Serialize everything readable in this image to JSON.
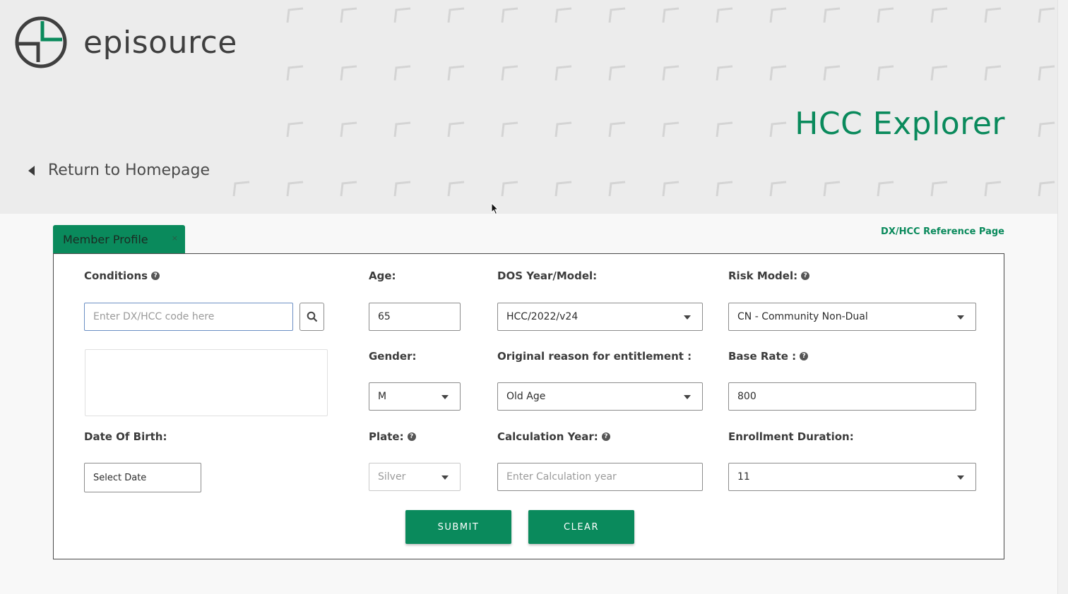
{
  "brand": {
    "name": "episource",
    "accent": "#0a8a5c"
  },
  "header": {
    "title": "HCC Explorer",
    "return_label": "Return to Homepage"
  },
  "tab": {
    "label": "Member Profile",
    "close": "×"
  },
  "reference_link": "DX/HCC Reference Page",
  "form": {
    "conditions": {
      "label": "Conditions",
      "placeholder": "Enter DX/HCC code here"
    },
    "date_of_birth": {
      "label": "Date Of Birth:",
      "value": "Select Date"
    },
    "age": {
      "label": "Age:",
      "value": "65"
    },
    "gender": {
      "label": "Gender:",
      "value": "M"
    },
    "plate": {
      "label": "Plate:",
      "value": "Silver"
    },
    "dos_year_model": {
      "label": "DOS Year/Model:",
      "value": "HCC/2022/v24"
    },
    "entitlement": {
      "label": "Original reason for entitlement :",
      "value": "Old Age"
    },
    "calculation_year": {
      "label": "Calculation Year:",
      "placeholder": "Enter Calculation year"
    },
    "risk_model": {
      "label": "Risk Model:",
      "value": "CN - Community Non-Dual"
    },
    "base_rate": {
      "label": "Base Rate :",
      "value": "800"
    },
    "enrollment_duration": {
      "label": "Enrollment Duration:",
      "value": "11"
    }
  },
  "actions": {
    "submit": "SUBMIT",
    "clear": "CLEAR"
  },
  "icons": {
    "help": "question-circle-icon",
    "search": "magnifier-icon",
    "back": "caret-left-icon"
  }
}
